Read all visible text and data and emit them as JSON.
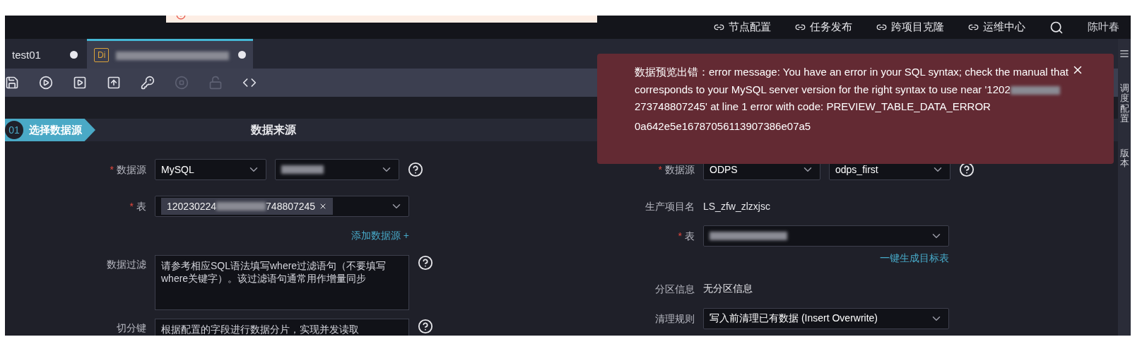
{
  "top_nav": {
    "banner": {
      "kind": "error"
    },
    "links": [
      "节点配置",
      "任务发布",
      "跨项目克隆",
      "运维中心"
    ],
    "user": "陈叶春"
  },
  "tabs": [
    {
      "label": "test01",
      "selected": false
    },
    {
      "badge": "Di",
      "redacted": true,
      "selected": true
    }
  ],
  "toolbar": [
    {
      "disabled": false
    },
    {
      "disabled": false
    },
    {
      "disabled": false
    },
    {
      "disabled": false
    },
    {
      "disabled": false
    },
    {
      "disabled": true
    },
    {
      "disabled": true
    },
    {
      "disabled": false
    }
  ],
  "step": {
    "number": "01",
    "label": "选择数据源"
  },
  "source": {
    "title": "数据来源",
    "rows": [
      {
        "kind": "selects",
        "label": "数据源",
        "required": "*",
        "help": true,
        "selects": [
          {
            "value": "MySQL"
          },
          {
            "redacted": true
          }
        ]
      },
      {
        "kind": "tag",
        "label": "表",
        "required": "*",
        "tag": {
          "prefix": "120230224",
          "suffix": "748807245"
        }
      },
      {
        "kind": "link",
        "text": "添加数据源 +"
      },
      {
        "kind": "textarea",
        "label": "数据过滤",
        "help": true,
        "placeholder": "请参考相应SQL语法填写where过滤语句（不要填写where关键字）。该过滤语句通常用作增量同步",
        "tall": true
      },
      {
        "kind": "textarea",
        "label": "切分键",
        "help": true,
        "placeholder": "根据配置的字段进行数据分片，实现并发读取",
        "tall": false
      }
    ]
  },
  "target": {
    "rows": [
      {
        "kind": "selects",
        "label": "数据源",
        "required": "*",
        "help": true,
        "selects": [
          {
            "value": "ODPS"
          },
          {
            "value": "odps_first"
          }
        ]
      },
      {
        "kind": "text",
        "label": "生产项目名",
        "value": "LS_zfw_zlzxjsc"
      },
      {
        "kind": "select",
        "label": "表",
        "required": "*",
        "redacted": true
      },
      {
        "kind": "link",
        "text": "一键生成目标表"
      },
      {
        "kind": "text",
        "label": "分区信息",
        "value": "无分区信息"
      },
      {
        "kind": "select",
        "label": "清理规则",
        "value": "写入前清理已有数据 (Insert Overwrite)"
      }
    ]
  },
  "right_sidebar": [
    "调度配置",
    "版本"
  ],
  "toast": {
    "message_before": "数据预览出错：error message: You have an error in your SQL syntax; check the manual that corresponds to your MySQL server version for the right syntax to use near '1202",
    "message_after": "273748807245' at line 1 error with code: PREVIEW_TABLE_DATA_ERROR",
    "request_id": "0a642e5e16787056113907386e07a5"
  }
}
